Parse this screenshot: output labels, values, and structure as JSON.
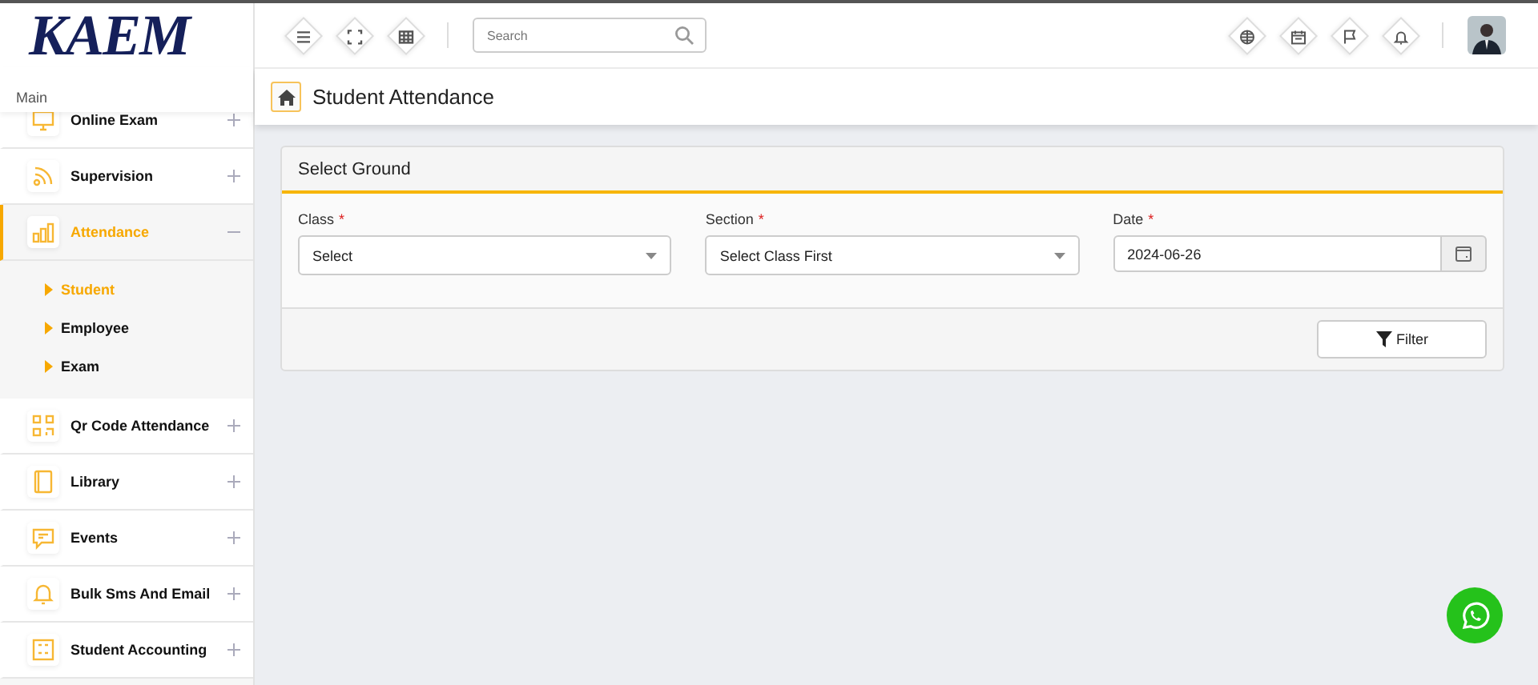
{
  "logo": "KAEM",
  "sidebar": {
    "section": "Main",
    "items": [
      {
        "label": "Online Exam",
        "selected": false,
        "expanded": false
      },
      {
        "label": "Supervision",
        "selected": false,
        "expanded": false
      },
      {
        "label": "Attendance",
        "selected": true,
        "expanded": true,
        "children": [
          {
            "label": "Student",
            "selected": true
          },
          {
            "label": "Employee",
            "selected": false
          },
          {
            "label": "Exam",
            "selected": false
          }
        ]
      },
      {
        "label": "Qr Code Attendance",
        "selected": false,
        "expanded": false
      },
      {
        "label": "Library",
        "selected": false,
        "expanded": false
      },
      {
        "label": "Events",
        "selected": false,
        "expanded": false
      },
      {
        "label": "Bulk Sms And Email",
        "selected": false,
        "expanded": false
      },
      {
        "label": "Student Accounting",
        "selected": false,
        "expanded": false
      }
    ]
  },
  "search": {
    "placeholder": "Search"
  },
  "page_title": "Student Attendance",
  "panel": {
    "title": "Select Ground",
    "fields": [
      {
        "kind": "select",
        "label": "Class",
        "required_mark": "*",
        "value": "Select"
      },
      {
        "kind": "select",
        "label": "Section",
        "required_mark": "*",
        "value": "Select Class First"
      },
      {
        "kind": "date",
        "label": "Date",
        "required_mark": "*",
        "value": "2024-06-26"
      }
    ],
    "button": "Filter"
  }
}
